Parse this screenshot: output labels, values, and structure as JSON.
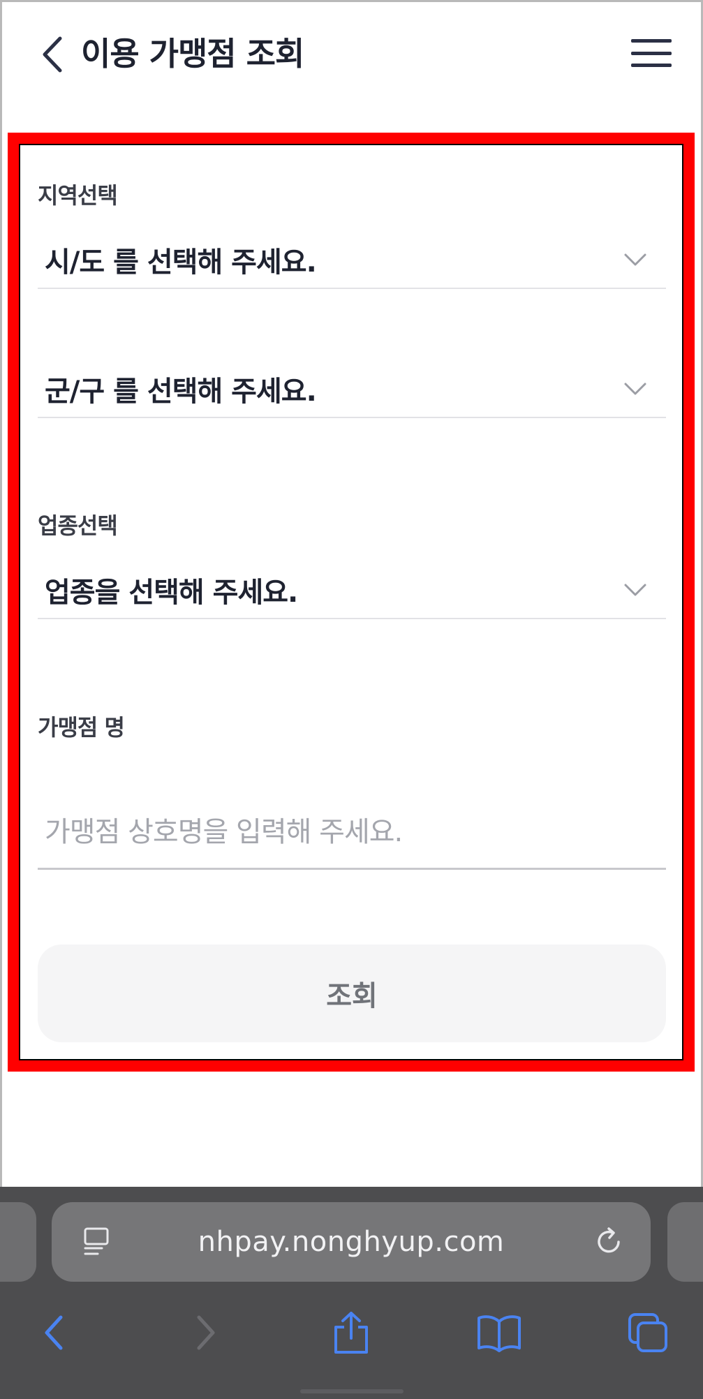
{
  "header": {
    "title": "이용 가맹점 조회"
  },
  "form": {
    "region_label": "지역선택",
    "sido_placeholder": "시/도 를 선택해 주세요.",
    "gungu_placeholder": "군/구 를 선택해 주세요.",
    "category_label": "업종선택",
    "category_placeholder": "업종을 선택해 주세요.",
    "merchant_label": "가맹점 명",
    "merchant_placeholder": "가맹점 상호명을 입력해 주세요.",
    "merchant_value": "",
    "search_button": "조회"
  },
  "browser": {
    "url": "nhpay.nonghyup.com"
  },
  "colors": {
    "accent_browser": "#4a83f1",
    "highlight": "#ff0000"
  },
  "icons": [
    "back-chevron-icon",
    "hamburger-menu-icon",
    "chevron-down-icon",
    "reader-icon",
    "reload-icon",
    "browser-back-icon",
    "browser-forward-icon",
    "share-icon",
    "bookmarks-icon",
    "tabs-icon"
  ]
}
